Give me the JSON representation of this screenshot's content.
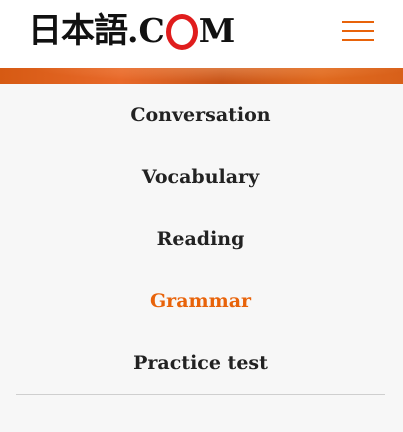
{
  "header": {
    "logo_kanji": "日本語",
    "logo_dot": ".",
    "logo_c": "C",
    "logo_m": "M",
    "menu_icon": "hamburger-menu-icon",
    "accent_color": "#e8630a",
    "logo_ring_color": "#e01d1d"
  },
  "nav": {
    "items": [
      {
        "label": "Conversation",
        "active": false
      },
      {
        "label": "Vocabulary",
        "active": false
      },
      {
        "label": "Reading",
        "active": false
      },
      {
        "label": "Grammar",
        "active": true
      },
      {
        "label": "Practice test",
        "active": false
      }
    ]
  }
}
